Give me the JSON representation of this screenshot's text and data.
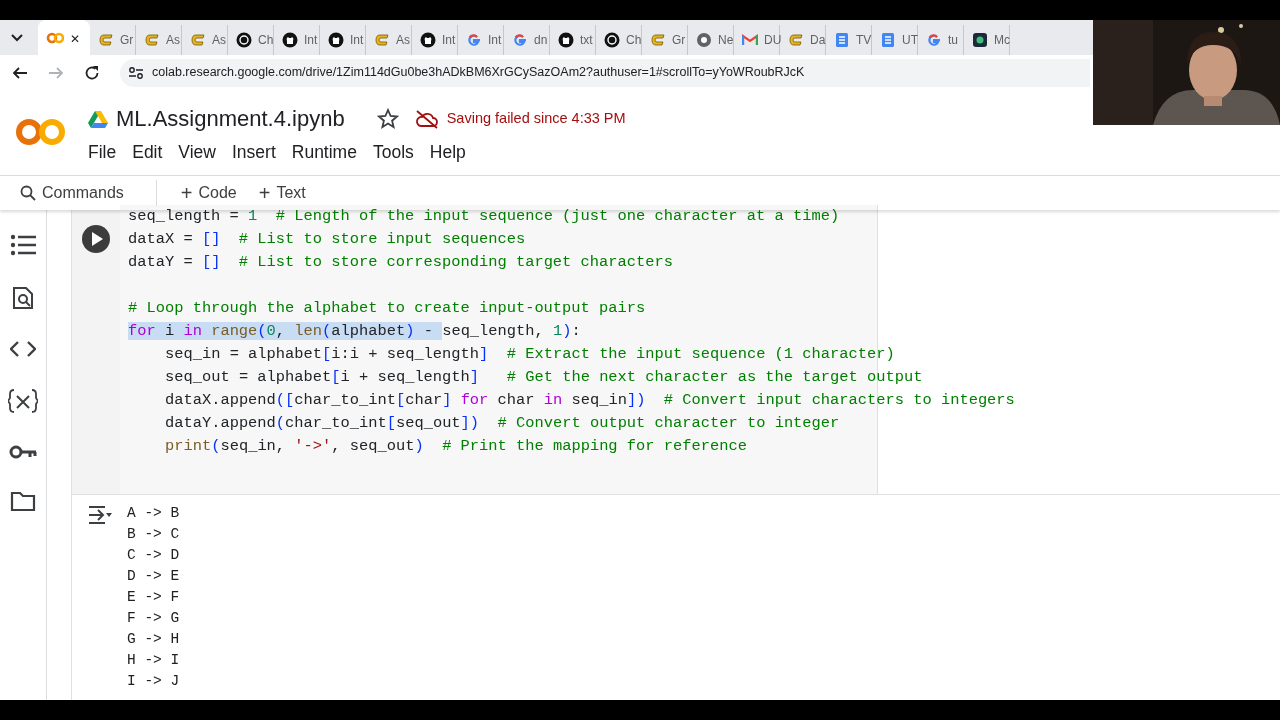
{
  "browser": {
    "tabs": [
      {
        "kind": "colab",
        "selected": true
      },
      {
        "label": "Gr",
        "kind": "c",
        "selected": false
      },
      {
        "label": "As",
        "kind": "c",
        "selected": false
      },
      {
        "label": "As",
        "kind": "c",
        "selected": false
      },
      {
        "label": "Ch",
        "kind": "ring",
        "selected": false
      },
      {
        "label": "Int",
        "kind": "octocat",
        "selected": false
      },
      {
        "label": "Int",
        "kind": "octocat",
        "selected": false
      },
      {
        "label": "As",
        "kind": "c",
        "selected": false
      },
      {
        "label": "Int",
        "kind": "octocat",
        "selected": false
      },
      {
        "label": "Int",
        "kind": "g",
        "selected": false
      },
      {
        "label": "dn",
        "kind": "g",
        "selected": false
      },
      {
        "label": "txt",
        "kind": "octocat",
        "selected": false
      },
      {
        "label": "Ch",
        "kind": "ring",
        "selected": false
      },
      {
        "label": "Gr",
        "kind": "c",
        "selected": false
      },
      {
        "label": "Ne",
        "kind": "chrome",
        "selected": false
      },
      {
        "label": "DU",
        "kind": "mail",
        "selected": false
      },
      {
        "label": "Da",
        "kind": "c",
        "selected": false
      },
      {
        "label": "TV",
        "kind": "doc",
        "selected": false
      },
      {
        "label": "UT",
        "kind": "doc",
        "selected": false
      },
      {
        "label": "tu",
        "kind": "g",
        "selected": false
      },
      {
        "label": "Mc",
        "kind": "app",
        "selected": false
      }
    ],
    "close_label": "✕",
    "forward_disabled": true,
    "url": "colab.research.google.com/drive/1Zim114dGu0be3hADkBM6XrGCySazOAm2?authuser=1#scrollTo=yYoWRoubRJcK"
  },
  "notebook": {
    "title": "ML.Assignment.4.ipynb",
    "starred": false,
    "save_status": "Saving failed since 4:33 PM",
    "menu": [
      "File",
      "Edit",
      "View",
      "Insert",
      "Runtime",
      "Tools",
      "Help"
    ],
    "toolbar": {
      "commands": "Commands",
      "add_code": "Code",
      "add_text": "Text",
      "plus": "+"
    }
  },
  "cell": {
    "blocks": [
      [
        {
          "tokens": [
            {
              "t": "seq_length = "
            },
            {
              "t": "1",
              "color": "#098658"
            },
            {
              "t": "  # Length of the input sequence (just one character at a time)",
              "color": "#008000"
            }
          ]
        },
        {
          "tokens": [
            {
              "t": "dataX = "
            },
            {
              "t": "[]",
              "color": "#0431fa"
            },
            {
              "t": "  # List to store input sequences",
              "color": "#008000"
            }
          ]
        },
        {
          "tokens": [
            {
              "t": "dataY = "
            },
            {
              "t": "[]",
              "color": "#0431fa"
            },
            {
              "t": "  # List to store corresponding target characters",
              "color": "#008000"
            }
          ]
        }
      ],
      [
        {
          "tokens": [
            {
              "t": "# Loop through the alphabet to create input-output pairs",
              "color": "#008000"
            }
          ]
        },
        {
          "tokens": [
            {
              "t": "for",
              "color": "#af00db",
              "selected": true
            },
            {
              "t": " i ",
              "selected": true
            },
            {
              "t": "in",
              "color": "#af00db",
              "selected": true
            },
            {
              "t": " range",
              "color": "#795e26",
              "selected": true
            },
            {
              "t": "(",
              "color": "#0431fa",
              "selected": true
            },
            {
              "t": "0",
              "color": "#098658",
              "selected": true
            },
            {
              "t": ", ",
              "selected": true
            },
            {
              "t": "len",
              "color": "#795e26",
              "selected": true
            },
            {
              "t": "(",
              "color": "#0431fa",
              "selected": true
            },
            {
              "t": "alphabet",
              "selected": true
            },
            {
              "t": ")",
              "color": "#0431fa",
              "selected": true
            },
            {
              "t": " - ",
              "selected": true
            },
            {
              "t": "seq_length, ",
              "selected": false
            },
            {
              "t": "1",
              "color": "#098658",
              "selected": false
            },
            {
              "t": ")",
              "color": "#0431fa",
              "selected": false
            },
            {
              "t": ":",
              "selected": false
            }
          ],
          "children": [
            {
              "tokens": [
                {
                  "t": "seq_in = alphabet"
                },
                {
                  "t": "[",
                  "color": "#0431fa"
                },
                {
                  "t": "i:i + seq_length"
                },
                {
                  "t": "]",
                  "color": "#0431fa"
                },
                {
                  "t": "  # Extract the input sequence (1 character)",
                  "color": "#008000"
                }
              ]
            },
            {
              "tokens": [
                {
                  "t": "seq_out = alphabet"
                },
                {
                  "t": "[",
                  "color": "#0431fa"
                },
                {
                  "t": "i + seq_length"
                },
                {
                  "t": "]",
                  "color": "#0431fa"
                },
                {
                  "t": "   # Get the next character as the target output",
                  "color": "#008000"
                }
              ]
            },
            {
              "tokens": [
                {
                  "t": "dataX.append"
                },
                {
                  "t": "([",
                  "color": "#0431fa"
                },
                {
                  "t": "char_to_int"
                },
                {
                  "t": "[",
                  "color": "#0431fa"
                },
                {
                  "t": "char"
                },
                {
                  "t": "] ",
                  "color": "#0431fa"
                },
                {
                  "t": "for",
                  "color": "#af00db"
                },
                {
                  "t": " char "
                },
                {
                  "t": "in",
                  "color": "#af00db"
                },
                {
                  "t": " seq_in"
                },
                {
                  "t": "])",
                  "color": "#0431fa"
                },
                {
                  "t": "  # Convert input characters to integers",
                  "color": "#008000"
                }
              ]
            },
            {
              "tokens": [
                {
                  "t": "dataY.append"
                },
                {
                  "t": "(",
                  "color": "#0431fa"
                },
                {
                  "t": "char_to_int"
                },
                {
                  "t": "[",
                  "color": "#0431fa"
                },
                {
                  "t": "seq_out"
                },
                {
                  "t": "])",
                  "color": "#0431fa"
                },
                {
                  "t": "  # Convert output character to integer",
                  "color": "#008000"
                }
              ]
            },
            {
              "tokens": [
                {
                  "t": "print",
                  "color": "#795e26"
                },
                {
                  "t": "(",
                  "color": "#0431fa"
                },
                {
                  "t": "seq_in, "
                },
                {
                  "t": "'->'",
                  "color": "#a31515"
                },
                {
                  "t": ", seq_out"
                },
                {
                  "t": ")",
                  "color": "#0431fa"
                },
                {
                  "t": "  # Print the mapping for reference",
                  "color": "#008000"
                }
              ]
            }
          ]
        }
      ]
    ],
    "output": [
      "A -> B",
      "B -> C",
      "C -> D",
      "D -> E",
      "E -> F",
      "F -> G",
      "G -> H",
      "H -> I",
      "I -> J"
    ]
  }
}
